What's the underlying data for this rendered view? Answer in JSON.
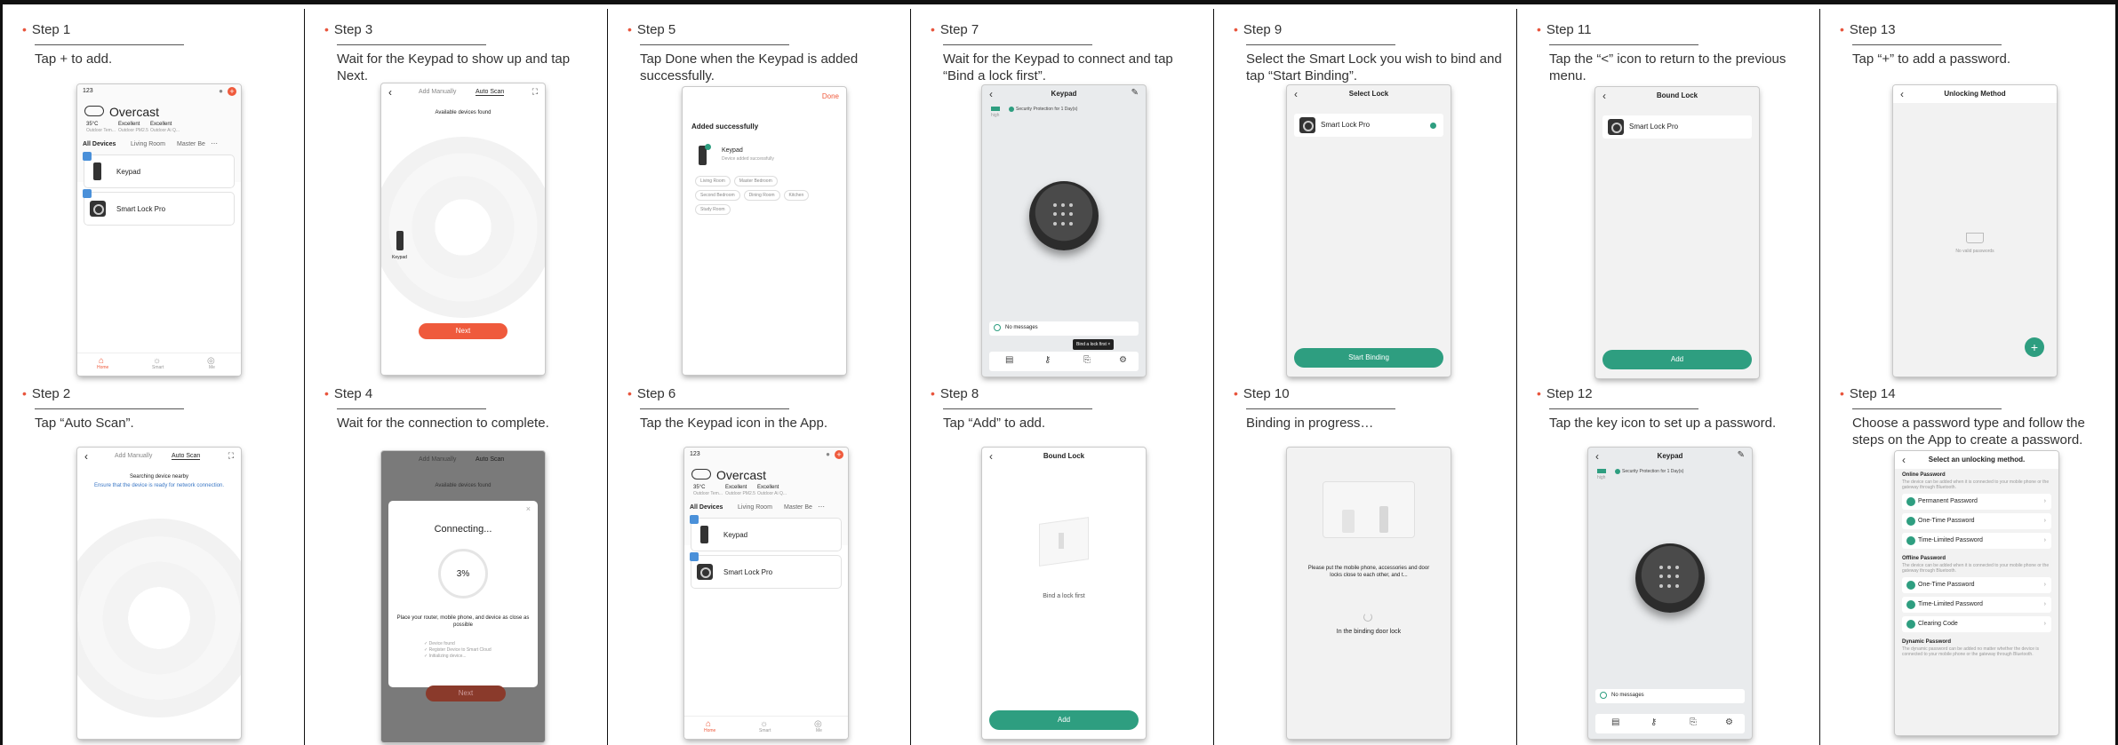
{
  "steps": {
    "s1": {
      "label": "Step 1",
      "desc": "Tap + to add."
    },
    "s2": {
      "label": "Step 2",
      "desc": "Tap “Auto Scan”."
    },
    "s3": {
      "label": "Step 3",
      "desc": "Wait for the Keypad to show up and tap Next."
    },
    "s4": {
      "label": "Step 4",
      "desc": "Wait for the connection to complete."
    },
    "s5": {
      "label": "Step 5",
      "desc": "Tap Done when the Keypad is added successfully."
    },
    "s6": {
      "label": "Step 6",
      "desc": "Tap the Keypad icon in the App."
    },
    "s7": {
      "label": "Step 7",
      "desc": "Wait for the Keypad to connect and tap “Bind a lock first”."
    },
    "s8": {
      "label": "Step 8",
      "desc": "Tap “Add” to add."
    },
    "s9": {
      "label": "Step 9",
      "desc": "Select the Smart Lock you wish to bind and tap “Start Binding”."
    },
    "s10": {
      "label": "Step 10",
      "desc": "Binding in progress…"
    },
    "s11": {
      "label": "Step 11",
      "desc": "Tap the “<” icon to return to the previous menu."
    },
    "s12": {
      "label": "Step 12",
      "desc": "Tap the key icon to set up a password."
    },
    "s13": {
      "label": "Step 13",
      "desc": "Tap “+” to add a password."
    },
    "s14": {
      "label": "Step 14",
      "desc": "Choose a password type and follow the steps on the App to create a password."
    }
  },
  "home": {
    "home_name": "123",
    "weather": "Overcast",
    "temp": "35°C",
    "temp_sub": "Outdoor Tem...",
    "pm": "Excellent",
    "pm_sub": "Outdoor PM2.5",
    "air": "Excellent",
    "air_sub": "Outdoor Ai Q...",
    "tab_all": "All Devices",
    "tab_living": "Living Room",
    "tab_master": "Master Be",
    "device_keypad": "Keypad",
    "device_lock": "Smart Lock Pro",
    "nav_home": "Home",
    "nav_smart": "Smart",
    "nav_me": "Me"
  },
  "scan": {
    "tab_manual": "Add Manually",
    "tab_auto": "Auto Scan",
    "found": "Available devices found",
    "searching": "Searching device nearby",
    "ensure": "Ensure that the device is ready for network connection.",
    "keypad_label": "Keypad",
    "next": "Next"
  },
  "connecting": {
    "title": "Connecting...",
    "percent": "3%",
    "hint": "Place your router, mobile phone, and device as close as possible",
    "item1": "✓ Device found",
    "item2": "✓ Register Device to Smart Cloud",
    "item3": "✓ Initializing device..."
  },
  "added": {
    "done": "Done",
    "title": "Added successfully",
    "device": "Keypad",
    "status": "Device added successfully",
    "rooms": [
      "Living Room",
      "Master Bedroom",
      "Second Bedroom",
      "Dining Room",
      "Kitchen",
      "Study Room"
    ]
  },
  "keypad": {
    "title": "Keypad",
    "signal": "high",
    "security": "Security Protection for 1 Day(s)",
    "no_messages": "No messages",
    "bind_tip": "Bind a lock first"
  },
  "bound": {
    "title": "Bound Lock",
    "empty": "Bind a lock first",
    "add": "Add",
    "lock": "Smart Lock Pro"
  },
  "select": {
    "title": "Select Lock",
    "lock": "Smart Lock Pro",
    "start": "Start Binding"
  },
  "binding": {
    "hint": "Please put the mobile phone, accessories and door locks close to each other, and t...",
    "progress": "In the binding door lock"
  },
  "unlock": {
    "title": "Unlocking Method",
    "empty": "No valid passwords",
    "plus": "+"
  },
  "select_method": {
    "title": "Select an unlocking method.",
    "online": "Online Password",
    "online_desc": "The device can be added when it is connected to your mobile phone or the gateway through Bluetooth.",
    "permanent": "Permanent Password",
    "one_time": "One-Time Password",
    "time_limited": "Time-Limited Password",
    "offline": "Offline Password",
    "offline_desc": "The device can be added when it is connected to your mobile phone or the gateway through Bluetooth.",
    "off_one_time": "One-Time Password",
    "off_time_limited": "Time-Limited Password",
    "clearing": "Clearing Code",
    "dynamic": "Dynamic Password",
    "dynamic_desc": "The dynamic password can be added no matter whether the device is connected to your mobile phone or the gateway through Bluetooth."
  },
  "colors": {
    "accent_red": "#ef5a3c",
    "accent_green": "#2e9e80",
    "bullet": "#e8553d"
  }
}
